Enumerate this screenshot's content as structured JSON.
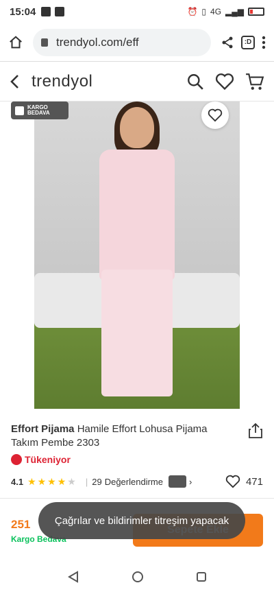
{
  "status": {
    "time": "15:04",
    "network": "4G"
  },
  "browser": {
    "url": "trendyol.com/eff",
    "tab_count": ":D"
  },
  "header": {
    "logo": "trendyol"
  },
  "product": {
    "cargo_badge_line1": "KARGO",
    "cargo_badge_line2": "BEDAVA",
    "brand": "Effort Pijama",
    "name": "Hamile Effort Lohusa Pijama Takım Pembe 2303",
    "stock_text": "Tükeniyor",
    "rating": "4.1",
    "stars_filled": 4,
    "stars_total": 5,
    "reviews": "29",
    "reviews_label": "Değerlendirme",
    "likes": "471"
  },
  "purchase": {
    "price": "251",
    "cargo": "Kargo Bedava",
    "add_to_cart": "Sepete Ekle"
  },
  "toast": {
    "message": "Çağrılar ve bildirimler titreşim yapacak"
  },
  "colors": {
    "accent": "#f27a1a",
    "cargo_green": "#0bc15c",
    "stock_red": "#dd2233"
  }
}
